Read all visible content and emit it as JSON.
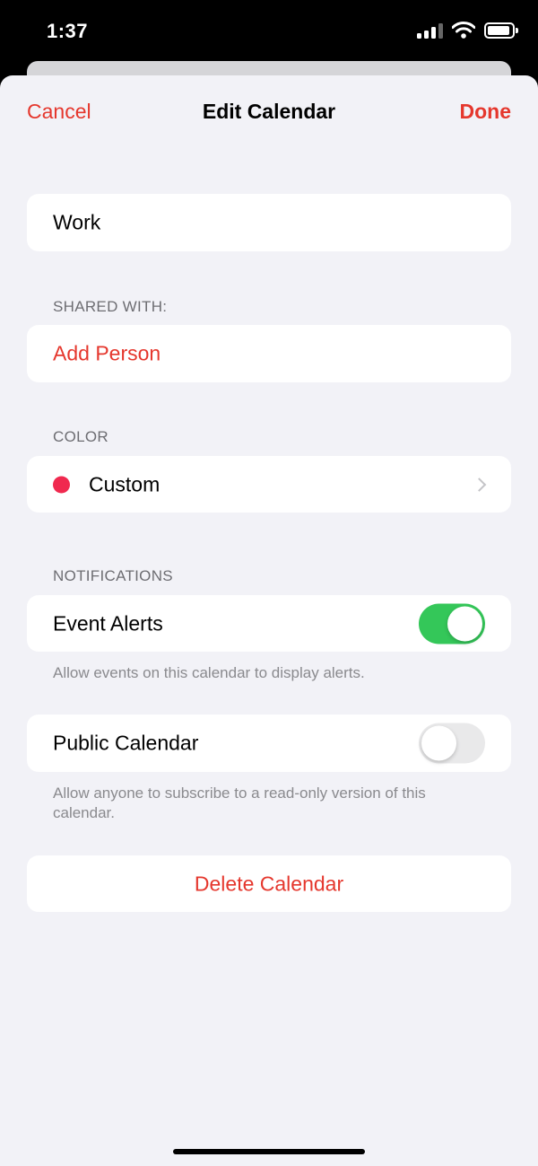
{
  "status_bar": {
    "time": "1:37"
  },
  "nav": {
    "cancel": "Cancel",
    "title": "Edit Calendar",
    "done": "Done"
  },
  "calendar_name": {
    "value": "Work"
  },
  "shared_with": {
    "header": "SHARED WITH:",
    "add_person": "Add Person"
  },
  "color": {
    "header": "COLOR",
    "label": "Custom",
    "swatch": "#f0294f"
  },
  "notifications": {
    "header": "NOTIFICATIONS",
    "event_alerts": {
      "label": "Event Alerts",
      "enabled": true
    },
    "event_alerts_note": "Allow events on this calendar to display alerts."
  },
  "public_calendar": {
    "label": "Public Calendar",
    "enabled": false,
    "note": "Allow anyone to subscribe to a read-only version of this calendar."
  },
  "delete": {
    "label": "Delete Calendar"
  },
  "colors": {
    "accent": "#e5372d",
    "toggle_on": "#34c759"
  }
}
